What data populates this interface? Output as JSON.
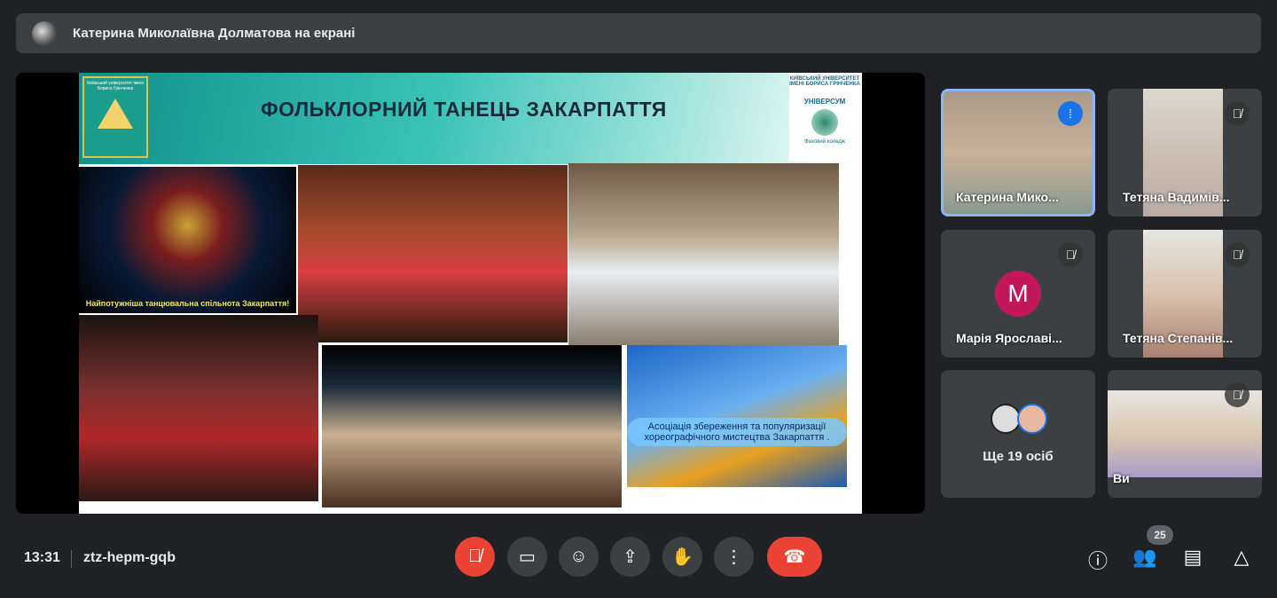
{
  "banner": {
    "text": "Катерина Миколаївна Долматова на екрані"
  },
  "slide": {
    "title": "ФОЛЬКЛОРНИЙ ТАНЕЦЬ ЗАКАРПАТТЯ",
    "logo_left": "Київський університет імені Бориса Грінченка",
    "logo_right_top": "КИЇВСЬКИЙ УНІВЕРСИТЕТ ІМЕНІ БОРИСА ГРІНЧЕНКА",
    "logo_right_name": "УНІВЕРСУМ",
    "logo_right_sub": "Фаховий коледж",
    "caption1": "Найпотужніша танцювальна спільнота Закарпаття!",
    "caption2": "Асоціація збереження та популяризації хореографічного мистецтва Закарпаття ."
  },
  "participants": [
    {
      "name": "Катерина Мико...",
      "state": "speaking"
    },
    {
      "name": "Тетяна Вадимів...",
      "state": "muted"
    },
    {
      "name": "Марія Ярославі...",
      "initial": "M",
      "avatar_color": "#c2185b",
      "state": "muted"
    },
    {
      "name": "Тетяна Степанів...",
      "state": "muted"
    },
    {
      "name": "Ще 19 осіб"
    },
    {
      "name": "Ви",
      "state": "muted"
    }
  ],
  "footer": {
    "time": "13:31",
    "meeting_code": "ztz-hepm-gqb",
    "participant_count": "25"
  },
  "colors": {
    "accent": "#8ab4f8",
    "danger": "#ea4335",
    "speaking": "#1a73e8"
  }
}
